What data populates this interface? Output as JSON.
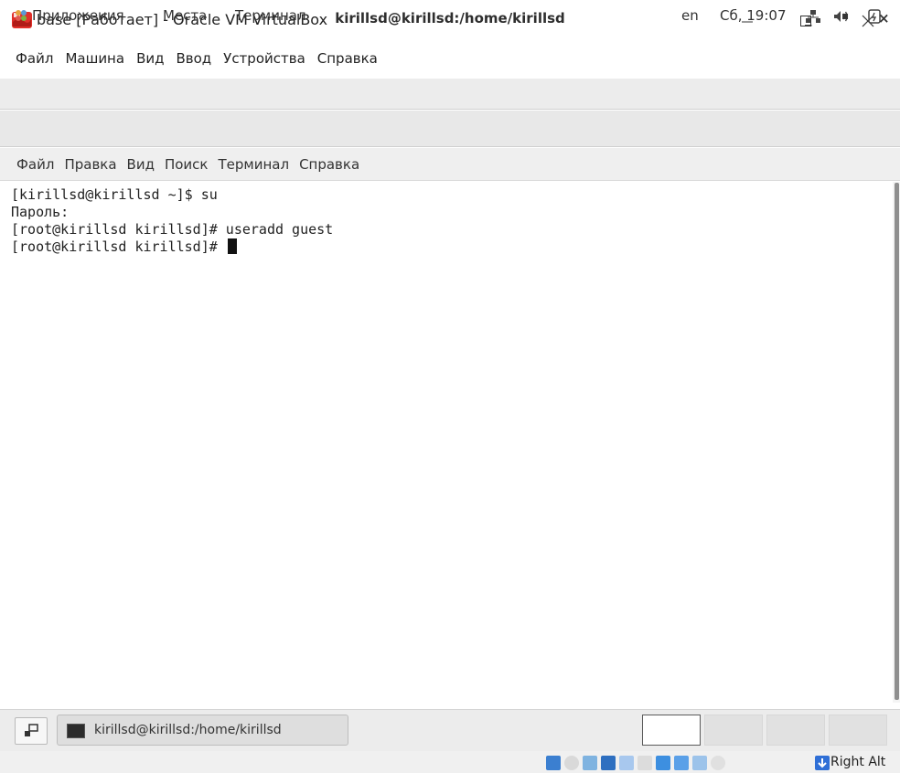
{
  "host_window": {
    "title": "base [Работает] - Oracle VM VirtualBox",
    "menu": [
      "Файл",
      "Машина",
      "Вид",
      "Ввод",
      "Устройства",
      "Справка"
    ],
    "controls": {
      "minimize": "—",
      "maximize": "☐",
      "close": "✕"
    }
  },
  "guest_panel": {
    "apps_label": "Приложения",
    "places_label": "Места",
    "terminal_label": "Терминал",
    "keyboard_layout": "en",
    "clock": "Сб, 19:07",
    "icons": [
      "network-icon",
      "volume-icon",
      "power-icon"
    ]
  },
  "terminal_window": {
    "title": "kirillsd@kirillsd:/home/kirillsd",
    "controls": {
      "minimize": "_",
      "maximize": "▪",
      "close": "×"
    },
    "menu": [
      "Файл",
      "Правка",
      "Вид",
      "Поиск",
      "Терминал",
      "Справка"
    ],
    "lines": [
      "[kirillsd@kirillsd ~]$ su",
      "Пароль:",
      "[root@kirillsd kirillsd]# useradd guest",
      "[root@kirillsd kirillsd]# "
    ]
  },
  "guest_taskbar": {
    "task_label": "kirillsd@kirillsd:/home/kirillsd",
    "workspaces": 4,
    "active_workspace": 1
  },
  "host_status": {
    "host_key": "Right Alt",
    "icons": [
      "storage-icon",
      "optical-icon",
      "audio-icon",
      "network-icon",
      "usb-icon",
      "shared-folders-icon",
      "display-icon",
      "capture-icon",
      "cpu-icon",
      "mouse-integration-icon",
      "host-key-icon"
    ]
  }
}
